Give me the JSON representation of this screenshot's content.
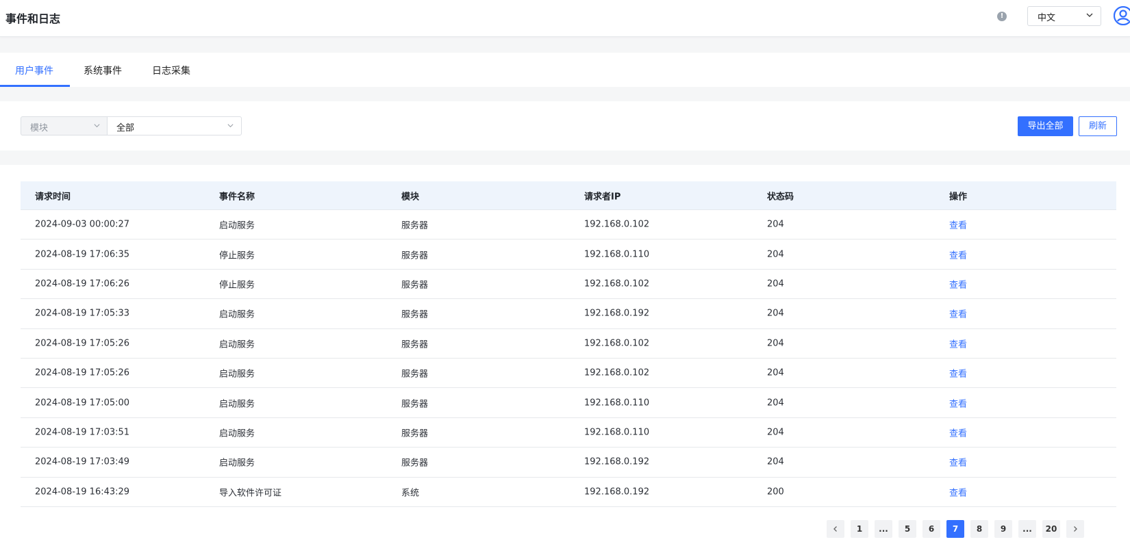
{
  "header": {
    "title": "事件和日志",
    "language": "中文"
  },
  "tabs": [
    {
      "label": "用户事件",
      "active": true
    },
    {
      "label": "系统事件",
      "active": false
    },
    {
      "label": "日志采集",
      "active": false
    }
  ],
  "filters": {
    "field_select": "模块",
    "value_select": "全部",
    "export_label": "导出全部",
    "refresh_label": "刷新"
  },
  "table": {
    "columns": [
      "请求时间",
      "事件名称",
      "模块",
      "请求者IP",
      "状态码",
      "操作"
    ],
    "rows": [
      [
        "2024-09-03 00:00:27",
        "启动服务",
        "服务器",
        "192.168.0.102",
        "204",
        "查看"
      ],
      [
        "2024-08-19 17:06:35",
        "停止服务",
        "服务器",
        "192.168.0.110",
        "204",
        "查看"
      ],
      [
        "2024-08-19 17:06:26",
        "停止服务",
        "服务器",
        "192.168.0.102",
        "204",
        "查看"
      ],
      [
        "2024-08-19 17:05:33",
        "启动服务",
        "服务器",
        "192.168.0.192",
        "204",
        "查看"
      ],
      [
        "2024-08-19 17:05:26",
        "启动服务",
        "服务器",
        "192.168.0.102",
        "204",
        "查看"
      ],
      [
        "2024-08-19 17:05:26",
        "启动服务",
        "服务器",
        "192.168.0.102",
        "204",
        "查看"
      ],
      [
        "2024-08-19 17:05:00",
        "启动服务",
        "服务器",
        "192.168.0.110",
        "204",
        "查看"
      ],
      [
        "2024-08-19 17:03:51",
        "启动服务",
        "服务器",
        "192.168.0.110",
        "204",
        "查看"
      ],
      [
        "2024-08-19 17:03:49",
        "启动服务",
        "服务器",
        "192.168.0.192",
        "204",
        "查看"
      ],
      [
        "2024-08-19 16:43:29",
        "导入软件许可证",
        "系统",
        "192.168.0.192",
        "200",
        "查看"
      ]
    ]
  },
  "pagination": {
    "pages": [
      "1",
      "...",
      "5",
      "6",
      "7",
      "8",
      "9",
      "...",
      "20"
    ],
    "current": "7"
  },
  "colors": {
    "accent": "#3370ff",
    "header_bg": "#eef4fc"
  },
  "icons": {
    "info": "info-icon",
    "language_dropdown": "chevron-down-icon",
    "user": "user-avatar-icon",
    "prev": "chevron-left-icon",
    "next": "chevron-right-icon"
  }
}
